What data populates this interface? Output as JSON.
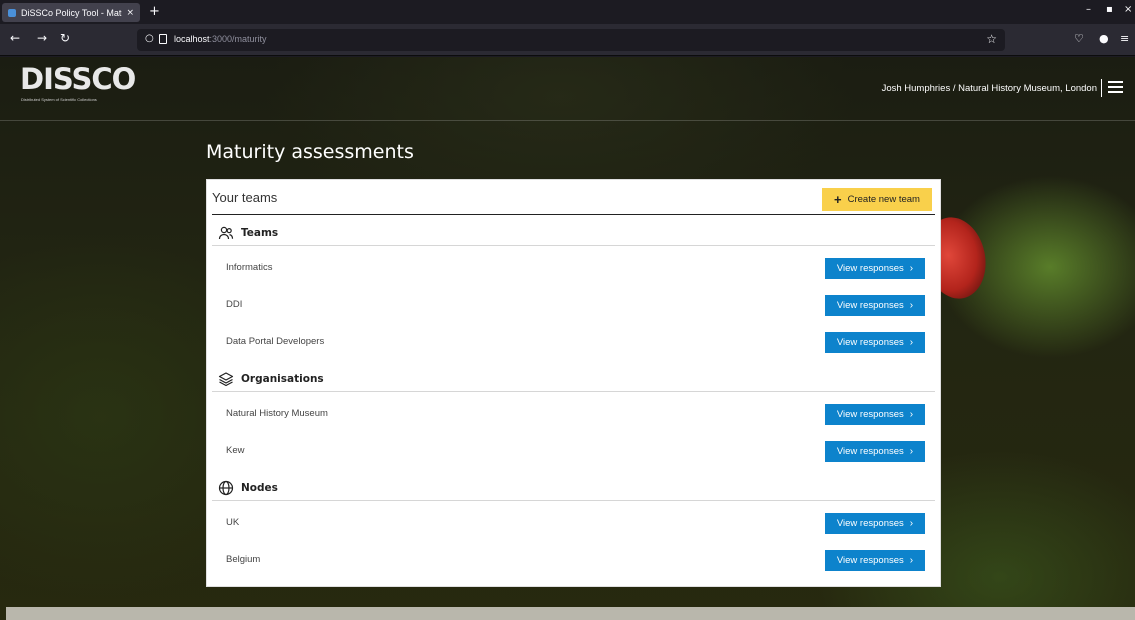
{
  "browser": {
    "tab_title": "DiSSCo Policy Tool - Maturi",
    "tab_close": "×",
    "new_tab": "+",
    "url_host": "localhost",
    "url_path": ":3000/maturity",
    "win_min": "–",
    "win_max": "▪",
    "win_close": "×"
  },
  "header": {
    "logo_text": "DISSCO",
    "logo_subtitle": "Distributed System of Scientific Collections",
    "user_label": "Josh Humphries / Natural History Museum, London"
  },
  "page": {
    "title": "Maturity assessments"
  },
  "card": {
    "title": "Your teams",
    "create_button": "Create new team",
    "view_button": "View responses",
    "sections": [
      {
        "label": "Teams",
        "icon": "users-icon",
        "rows": [
          "Informatics",
          "DDI",
          "Data Portal Developers"
        ]
      },
      {
        "label": "Organisations",
        "icon": "layers-icon",
        "rows": [
          "Natural History Museum",
          "Kew"
        ]
      },
      {
        "label": "Nodes",
        "icon": "globe-icon",
        "rows": [
          "UK",
          "Belgium"
        ]
      }
    ]
  },
  "colors": {
    "create_button": "#f9d04b",
    "view_button": "#0d83cc"
  }
}
